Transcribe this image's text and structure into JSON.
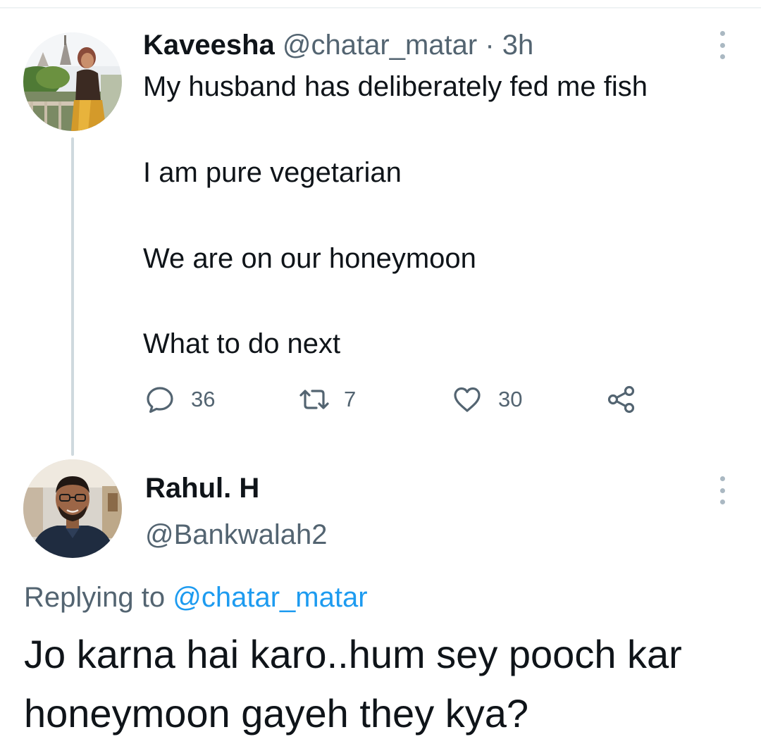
{
  "tweet": {
    "author_name": "Kaveesha",
    "author_handle": "@chatar_matar",
    "separator": "·",
    "time": "3h",
    "lines": [
      "My husband has deliberately fed me fish",
      "I am pure vegetarian",
      "We are on our honeymoon",
      "What to do next"
    ],
    "actions": {
      "replies": "36",
      "retweets": "7",
      "likes": "30"
    }
  },
  "reply": {
    "author_name": "Rahul. H",
    "author_handle": "@Bankwalah2",
    "replying_prefix": "Replying to",
    "replying_to": "@chatar_matar",
    "text": "Jo karna hai karo..hum sey pooch kar honeymoon gayeh they kya?"
  },
  "icons": {
    "reply": "speech-bubble-icon",
    "retweet": "retweet-icon",
    "like": "heart-icon",
    "share": "share-icon",
    "more": "vertical-ellipsis-icon"
  },
  "colors": {
    "text": "#0f1419",
    "secondary": "#536471",
    "link": "#1d9bf0",
    "thread_line": "#cfd9de"
  }
}
